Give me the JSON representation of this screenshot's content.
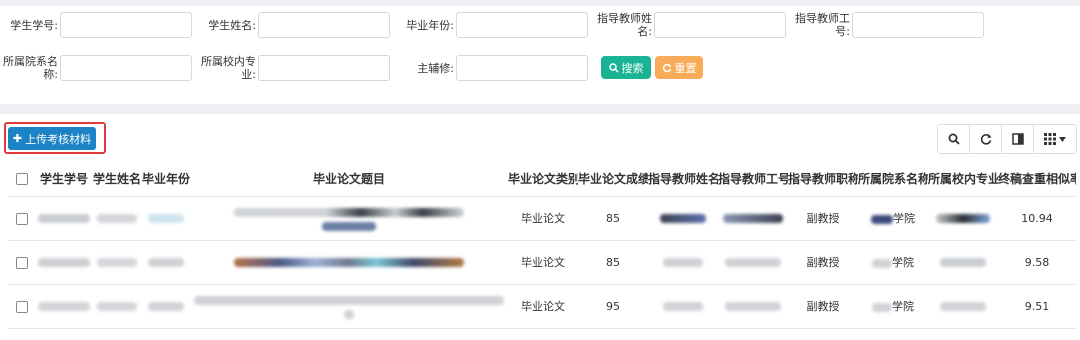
{
  "filters": {
    "student_id": "学生学号:",
    "student_name": "学生姓名:",
    "grad_year": "毕业年份:",
    "advisor_name_1": "指导教师姓",
    "advisor_name_2": "名:",
    "advisor_id_1": "指导教师工",
    "advisor_id_2": "号:",
    "dept_1": "所属院系名",
    "dept_2": "称:",
    "major_1": "所属校内专",
    "major_2": "业:",
    "minor": "主辅修:",
    "search_label": "搜索",
    "reset_label": "重置"
  },
  "toolbar": {
    "upload_label": "上传考核材料"
  },
  "table": {
    "headers": [
      "学生学号",
      "学生姓名",
      "毕业年份",
      "毕业论文题目",
      "毕业论文类别",
      "毕业论文成绩",
      "指导教师姓名",
      "指导教师工号",
      "指导教师职称",
      "所属院系名称",
      "所属校内专业",
      "终稿查重相似率"
    ],
    "rows": [
      {
        "category": "毕业论文",
        "score": "85",
        "title_rank": "副教授",
        "dept": "学院",
        "similarity": "10.94"
      },
      {
        "category": "毕业论文",
        "score": "85",
        "title_rank": "副教授",
        "dept": "学院",
        "similarity": "9.58"
      },
      {
        "category": "毕业论文",
        "score": "95",
        "title_rank": "副教授",
        "dept": "学院",
        "similarity": "9.51"
      }
    ]
  },
  "colors": {
    "search": "#1ab394",
    "reset": "#f8ac59",
    "upload": "#1c84c6",
    "highlight": "#e03a3a"
  }
}
